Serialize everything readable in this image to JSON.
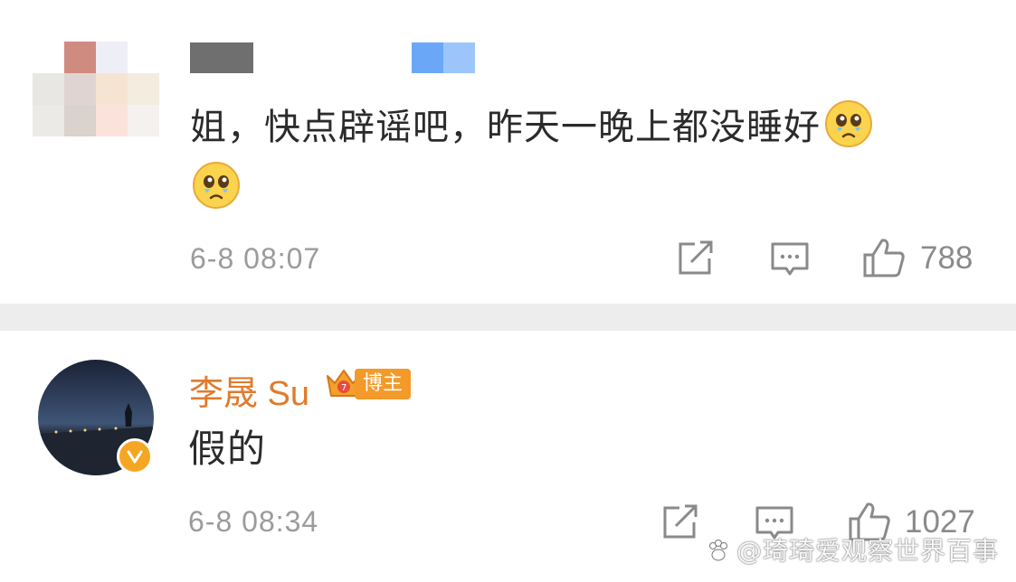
{
  "comments": [
    {
      "text_line1": "姐，快点辟谣吧，昨天一晚上都没睡好",
      "time": "6-8 08:07",
      "like_count": "788",
      "emoji_name": "crying-face"
    },
    {
      "author": "李晟 Su",
      "badge_label": "博主",
      "text": "假的",
      "time": "6-8 08:34",
      "like_count": "1027"
    }
  ],
  "watermark": "@琦琦爱观察世界百事",
  "icons": {
    "share": "share-icon",
    "comment": "comment-icon",
    "like": "thumbs-up-icon",
    "verified": "verified-v-icon",
    "crown": "crown-icon"
  },
  "colors": {
    "author_name": "#e07b2d",
    "badge": "#f39a2a",
    "verified": "#f5a623",
    "separator": "#ededed",
    "meta_text": "#9b9b9b"
  }
}
